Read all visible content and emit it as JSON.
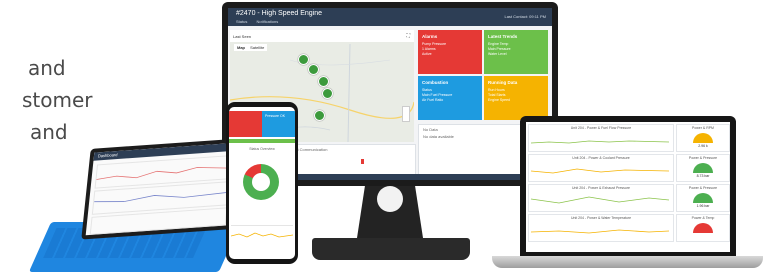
{
  "left_text": {
    "line1": "and",
    "line2": "stomer",
    "line3": "and"
  },
  "monitor": {
    "title": "#2470 - High Speed Engine",
    "nav": [
      "Status",
      "Notifications"
    ],
    "header_right": "Last Contact: 09:11 PM",
    "map": {
      "tabs": [
        "Map",
        "Satellite"
      ],
      "toolbar_label": "Last Seen"
    },
    "tiles": [
      {
        "title": "Alarms",
        "color": "#e53935",
        "lines": [
          "Pump Pressure",
          "1 Alarms",
          "Active"
        ]
      },
      {
        "title": "Latest Trends",
        "color": "#6cc04a",
        "lines": [
          "Engine Temp",
          "Main Pressure",
          "Water Level"
        ]
      },
      {
        "title": "Combustion",
        "color": "#1e9be0",
        "lines": [
          "Status",
          "Main Fuel Pressure",
          "Air Fuel Ratio"
        ]
      },
      {
        "title": "Running Data",
        "color": "#f5b301",
        "lines": [
          "Run Hours",
          "Total Starts",
          "Engine Speed"
        ]
      }
    ],
    "bottom_left_label": "Map Data",
    "bottom_left_sub": "Last Communication",
    "bottom_right_label": "No Data",
    "bottom_right_sub": "No data available"
  },
  "phone": {
    "alarm_label": "Pressure OK",
    "donut_title": "Status Overview",
    "donut_values": {
      "ok": 82,
      "alarm": 18
    },
    "colors": {
      "ok": "#4caf50",
      "alarm": "#e53935"
    }
  },
  "laptop": {
    "charts": [
      "Unit 204 - Power & Fuel Flow Pressure",
      "Unit 204 - Power & Coolant Pressure",
      "Unit 204 - Power & Exhaust Pressure",
      "Unit 204 - Power & Water Temperature"
    ],
    "gauges": [
      {
        "title": "Power & RPM",
        "value": "2.96 k",
        "color": "#f5b301"
      },
      {
        "title": "Power & Pressure",
        "value": "8.73 bar",
        "color": "#4caf50"
      },
      {
        "title": "Power & Pressure",
        "value": "1.96 bar",
        "color": "#4caf50"
      },
      {
        "title": "Power & Temp",
        "value": "",
        "color": "#e53935"
      }
    ]
  },
  "tablet": {
    "title": "Dashboard"
  }
}
